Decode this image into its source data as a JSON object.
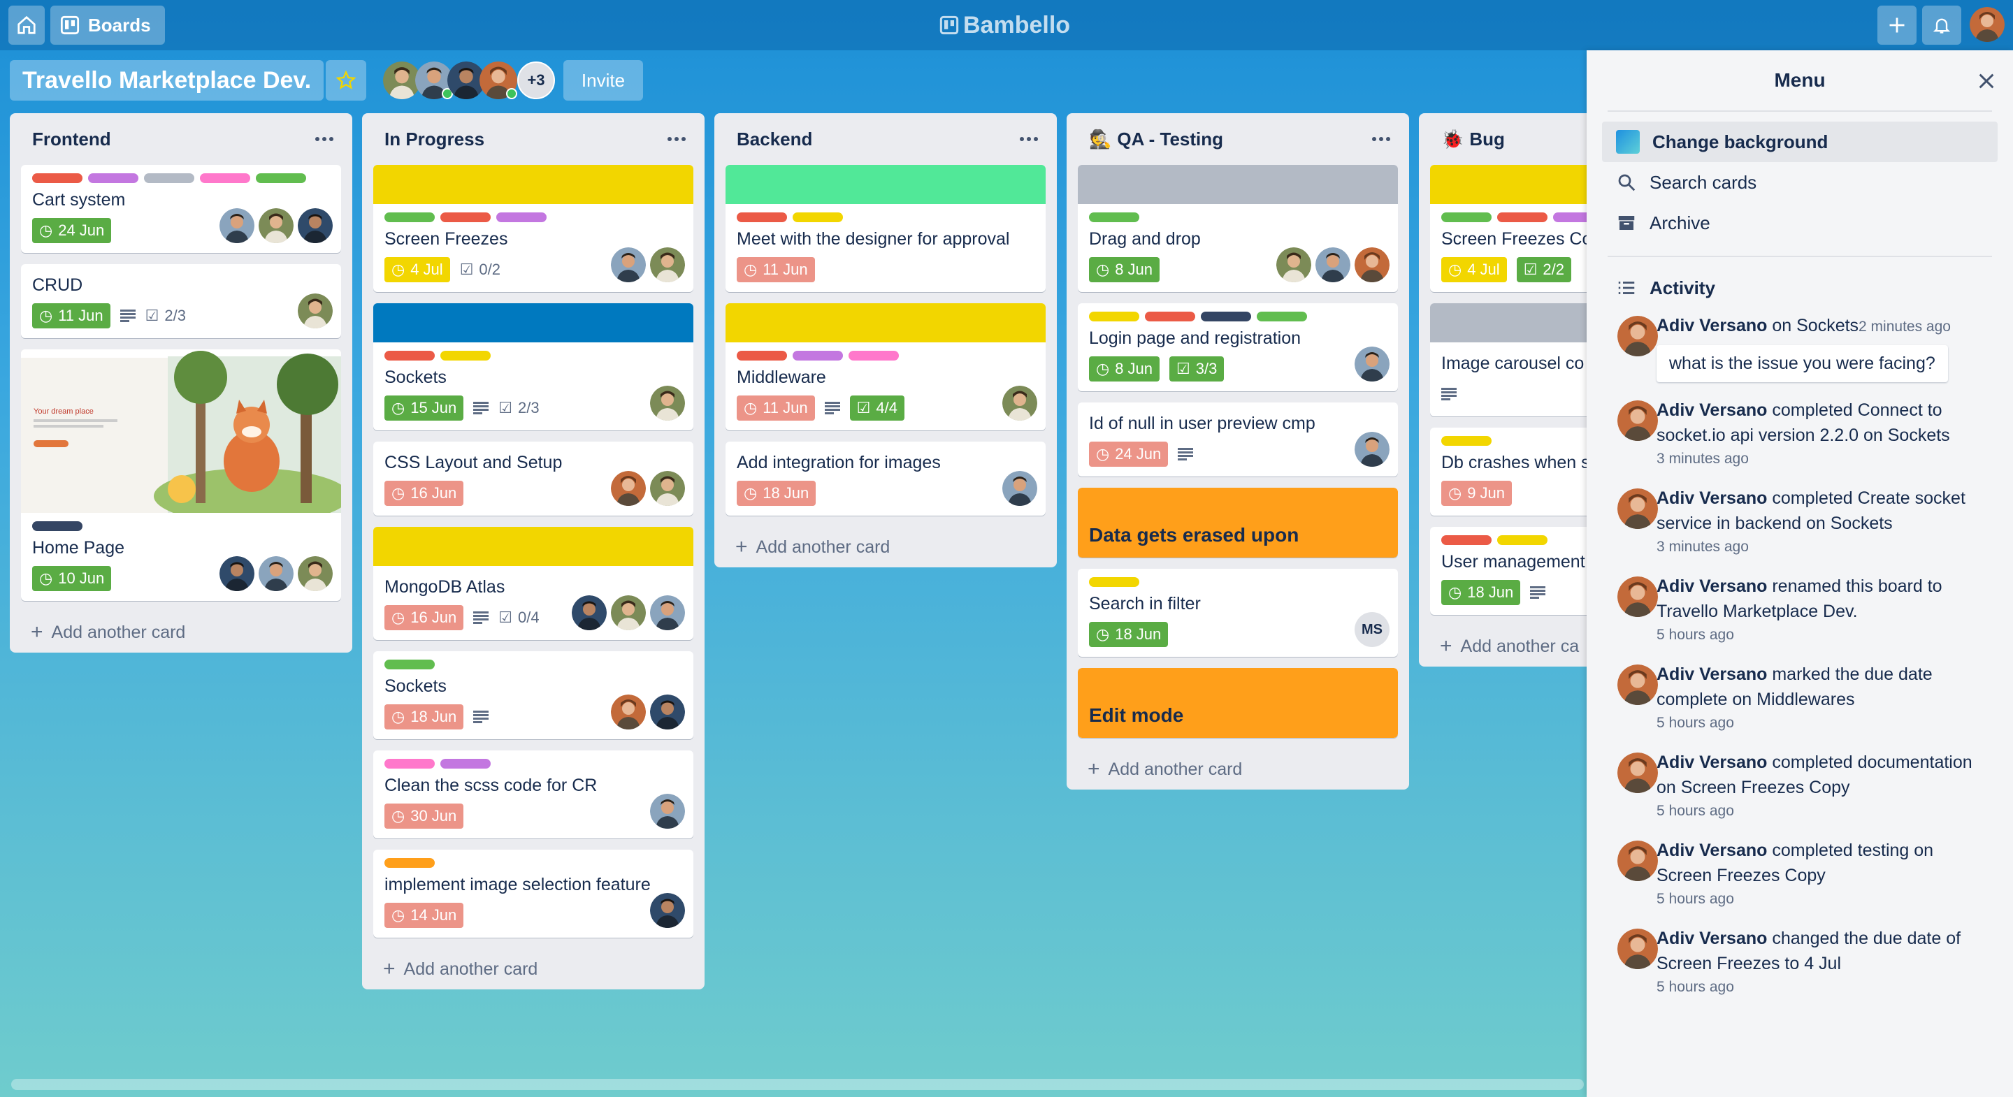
{
  "colors": {
    "green": "#61bd4f",
    "red": "#eb5a46",
    "purple": "#c377e0",
    "grey": "#b3bac5",
    "pink": "#ff78cb",
    "yellow": "#f2d600",
    "navy": "#344563",
    "orange": "#ff9f1a",
    "blue": "#0079bf",
    "lime": "#51e898"
  },
  "topbar": {
    "boards_label": "Boards",
    "brand": "Bambello"
  },
  "board": {
    "title": "Travello Marketplace Dev.",
    "members_more": "+3",
    "invite_label": "Invite"
  },
  "lists": {
    "frontend": {
      "title": "Frontend",
      "add_card": "Add another card",
      "cards": [
        {
          "title": "Cart system",
          "due": "24 Jun"
        },
        {
          "title": "CRUD",
          "due": "11 Jun",
          "checklist": "2/3"
        },
        {
          "title": "Home Page",
          "due": "10 Jun",
          "thumb_heading": "Your dream place"
        }
      ]
    },
    "inprogress": {
      "title": "In Progress",
      "add_card": "Add another card",
      "cards": [
        {
          "title": "Screen Freezes",
          "due": "4 Jul",
          "checklist": "0/2"
        },
        {
          "title": "Sockets",
          "due": "15 Jun",
          "checklist": "2/3"
        },
        {
          "title": "CSS Layout and Setup",
          "due": "16 Jun"
        },
        {
          "title": "MongoDB Atlas",
          "due": "16 Jun",
          "checklist": "0/4"
        },
        {
          "title": "Sockets",
          "due": "18 Jun"
        },
        {
          "title": "Clean the scss code for CR",
          "due": "30 Jun"
        },
        {
          "title": "implement image selection feature",
          "due": "14 Jun"
        }
      ]
    },
    "backend": {
      "title": "Backend",
      "add_card": "Add another card",
      "cards": [
        {
          "title": "Meet with the designer for approval",
          "due": "11 Jun"
        },
        {
          "title": "Middleware",
          "due": "11 Jun",
          "checklist": "4/4"
        },
        {
          "title": "Add integration for images",
          "due": "18 Jun"
        }
      ]
    },
    "qa": {
      "title": "QA - Testing",
      "add_card": "Add another card",
      "cards": [
        {
          "title": "Drag and drop",
          "due": "8 Jun"
        },
        {
          "title": "Login page and registration",
          "due": "8 Jun",
          "checklist": "3/3"
        },
        {
          "title": "Id of null in user preview cmp",
          "due": "24 Jun"
        },
        {
          "title": "Data gets erased upon"
        },
        {
          "title": "Search in filter",
          "due": "18 Jun",
          "member_initials": "MS"
        },
        {
          "title": "Edit mode"
        }
      ]
    },
    "bug": {
      "title": "Bug",
      "add_card": "Add another ca",
      "cards": [
        {
          "title": "Screen Freezes Co",
          "due": "4 Jul",
          "checklist": "2/2"
        },
        {
          "title": "Image carousel co"
        },
        {
          "title": "Db crashes when special characters",
          "due": "9 Jun"
        },
        {
          "title": "User management",
          "due": "18 Jun"
        }
      ]
    }
  },
  "menu": {
    "title": "Menu",
    "items": [
      "Change background",
      "Search cards",
      "Archive"
    ],
    "activity_title": "Activity",
    "activities": [
      {
        "user": "Adiv Versano",
        "text": "on Sockets",
        "time": "2 minutes ago",
        "comment": "what is the issue you were facing?"
      },
      {
        "user": "Adiv Versano",
        "text": "completed Connect to socket.io api version 2.2.0 on Sockets",
        "time": "3 minutes ago"
      },
      {
        "user": "Adiv Versano",
        "text": "completed Create socket service in backend on Sockets",
        "time": "3 minutes ago"
      },
      {
        "user": "Adiv Versano",
        "text": "renamed this board to Travello Marketplace Dev.",
        "time": "5 hours ago"
      },
      {
        "user": "Adiv Versano",
        "text": "marked the due date complete on Middlewares",
        "time": "5 hours ago"
      },
      {
        "user": "Adiv Versano",
        "text": "completed documentation on Screen Freezes Copy",
        "time": "5 hours ago"
      },
      {
        "user": "Adiv Versano",
        "text": "completed testing on Screen Freezes Copy",
        "time": "5 hours ago"
      },
      {
        "user": "Adiv Versano",
        "text": "changed the due date of Screen Freezes to 4 Jul",
        "time": "5 hours ago"
      }
    ]
  }
}
